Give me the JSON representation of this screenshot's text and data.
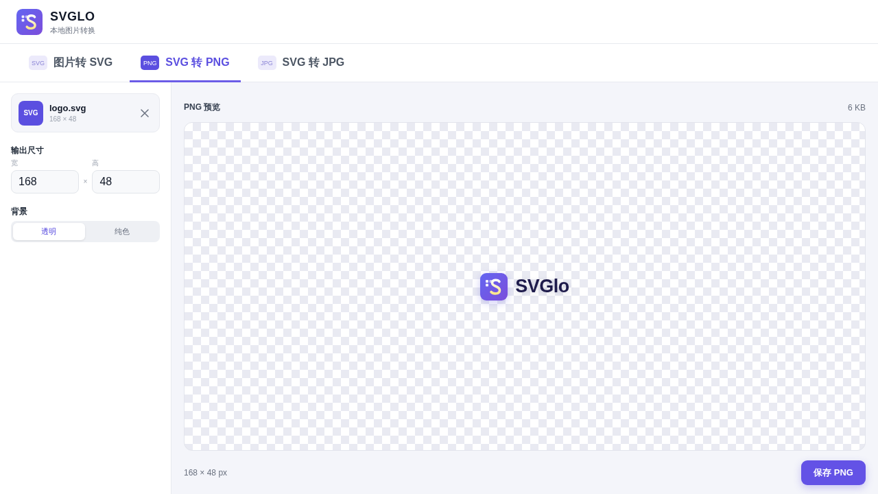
{
  "app": {
    "title": "SVGLO",
    "subtitle": "本地图片转换"
  },
  "tabs": [
    {
      "badge": "SVG",
      "label": "图片转 SVG",
      "selected": false
    },
    {
      "badge": "PNG",
      "label": "SVG 转 PNG",
      "selected": true
    },
    {
      "badge": "JPG",
      "label": "SVG 转 JPG",
      "selected": false
    }
  ],
  "sidebar": {
    "file": {
      "badge": "SVG",
      "name": "logo.svg",
      "dimensions": "168 × 48"
    },
    "size": {
      "title": "输出尺寸",
      "fields": [
        {
          "label": "宽",
          "value": "168"
        },
        {
          "label": "高",
          "value": "48"
        }
      ],
      "separator": "×"
    },
    "background": {
      "title": "背景",
      "options": [
        {
          "label": "透明",
          "selected": true
        },
        {
          "label": "纯色",
          "selected": false
        }
      ]
    }
  },
  "preview": {
    "title": "PNG 预览",
    "file_size": "6 KB",
    "logo_text": "SVGlo",
    "info": "168 × 48 px",
    "save_button": "保存 PNG"
  }
}
